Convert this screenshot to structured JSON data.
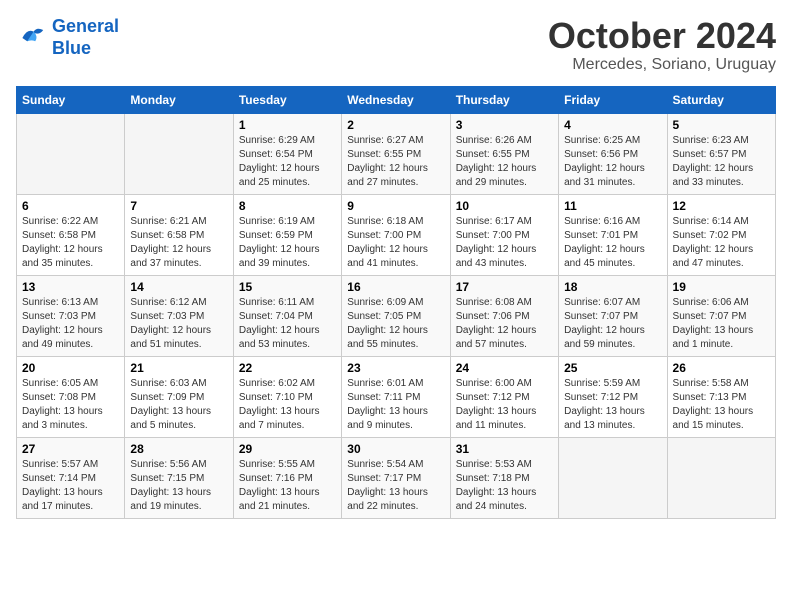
{
  "header": {
    "logo_line1": "General",
    "logo_line2": "Blue",
    "month": "October 2024",
    "location": "Mercedes, Soriano, Uruguay"
  },
  "weekdays": [
    "Sunday",
    "Monday",
    "Tuesday",
    "Wednesday",
    "Thursday",
    "Friday",
    "Saturday"
  ],
  "weeks": [
    [
      {
        "day": "",
        "sunrise": "",
        "sunset": "",
        "daylight": ""
      },
      {
        "day": "",
        "sunrise": "",
        "sunset": "",
        "daylight": ""
      },
      {
        "day": "1",
        "sunrise": "Sunrise: 6:29 AM",
        "sunset": "Sunset: 6:54 PM",
        "daylight": "Daylight: 12 hours and 25 minutes."
      },
      {
        "day": "2",
        "sunrise": "Sunrise: 6:27 AM",
        "sunset": "Sunset: 6:55 PM",
        "daylight": "Daylight: 12 hours and 27 minutes."
      },
      {
        "day": "3",
        "sunrise": "Sunrise: 6:26 AM",
        "sunset": "Sunset: 6:55 PM",
        "daylight": "Daylight: 12 hours and 29 minutes."
      },
      {
        "day": "4",
        "sunrise": "Sunrise: 6:25 AM",
        "sunset": "Sunset: 6:56 PM",
        "daylight": "Daylight: 12 hours and 31 minutes."
      },
      {
        "day": "5",
        "sunrise": "Sunrise: 6:23 AM",
        "sunset": "Sunset: 6:57 PM",
        "daylight": "Daylight: 12 hours and 33 minutes."
      }
    ],
    [
      {
        "day": "6",
        "sunrise": "Sunrise: 6:22 AM",
        "sunset": "Sunset: 6:58 PM",
        "daylight": "Daylight: 12 hours and 35 minutes."
      },
      {
        "day": "7",
        "sunrise": "Sunrise: 6:21 AM",
        "sunset": "Sunset: 6:58 PM",
        "daylight": "Daylight: 12 hours and 37 minutes."
      },
      {
        "day": "8",
        "sunrise": "Sunrise: 6:19 AM",
        "sunset": "Sunset: 6:59 PM",
        "daylight": "Daylight: 12 hours and 39 minutes."
      },
      {
        "day": "9",
        "sunrise": "Sunrise: 6:18 AM",
        "sunset": "Sunset: 7:00 PM",
        "daylight": "Daylight: 12 hours and 41 minutes."
      },
      {
        "day": "10",
        "sunrise": "Sunrise: 6:17 AM",
        "sunset": "Sunset: 7:00 PM",
        "daylight": "Daylight: 12 hours and 43 minutes."
      },
      {
        "day": "11",
        "sunrise": "Sunrise: 6:16 AM",
        "sunset": "Sunset: 7:01 PM",
        "daylight": "Daylight: 12 hours and 45 minutes."
      },
      {
        "day": "12",
        "sunrise": "Sunrise: 6:14 AM",
        "sunset": "Sunset: 7:02 PM",
        "daylight": "Daylight: 12 hours and 47 minutes."
      }
    ],
    [
      {
        "day": "13",
        "sunrise": "Sunrise: 6:13 AM",
        "sunset": "Sunset: 7:03 PM",
        "daylight": "Daylight: 12 hours and 49 minutes."
      },
      {
        "day": "14",
        "sunrise": "Sunrise: 6:12 AM",
        "sunset": "Sunset: 7:03 PM",
        "daylight": "Daylight: 12 hours and 51 minutes."
      },
      {
        "day": "15",
        "sunrise": "Sunrise: 6:11 AM",
        "sunset": "Sunset: 7:04 PM",
        "daylight": "Daylight: 12 hours and 53 minutes."
      },
      {
        "day": "16",
        "sunrise": "Sunrise: 6:09 AM",
        "sunset": "Sunset: 7:05 PM",
        "daylight": "Daylight: 12 hours and 55 minutes."
      },
      {
        "day": "17",
        "sunrise": "Sunrise: 6:08 AM",
        "sunset": "Sunset: 7:06 PM",
        "daylight": "Daylight: 12 hours and 57 minutes."
      },
      {
        "day": "18",
        "sunrise": "Sunrise: 6:07 AM",
        "sunset": "Sunset: 7:07 PM",
        "daylight": "Daylight: 12 hours and 59 minutes."
      },
      {
        "day": "19",
        "sunrise": "Sunrise: 6:06 AM",
        "sunset": "Sunset: 7:07 PM",
        "daylight": "Daylight: 13 hours and 1 minute."
      }
    ],
    [
      {
        "day": "20",
        "sunrise": "Sunrise: 6:05 AM",
        "sunset": "Sunset: 7:08 PM",
        "daylight": "Daylight: 13 hours and 3 minutes."
      },
      {
        "day": "21",
        "sunrise": "Sunrise: 6:03 AM",
        "sunset": "Sunset: 7:09 PM",
        "daylight": "Daylight: 13 hours and 5 minutes."
      },
      {
        "day": "22",
        "sunrise": "Sunrise: 6:02 AM",
        "sunset": "Sunset: 7:10 PM",
        "daylight": "Daylight: 13 hours and 7 minutes."
      },
      {
        "day": "23",
        "sunrise": "Sunrise: 6:01 AM",
        "sunset": "Sunset: 7:11 PM",
        "daylight": "Daylight: 13 hours and 9 minutes."
      },
      {
        "day": "24",
        "sunrise": "Sunrise: 6:00 AM",
        "sunset": "Sunset: 7:12 PM",
        "daylight": "Daylight: 13 hours and 11 minutes."
      },
      {
        "day": "25",
        "sunrise": "Sunrise: 5:59 AM",
        "sunset": "Sunset: 7:12 PM",
        "daylight": "Daylight: 13 hours and 13 minutes."
      },
      {
        "day": "26",
        "sunrise": "Sunrise: 5:58 AM",
        "sunset": "Sunset: 7:13 PM",
        "daylight": "Daylight: 13 hours and 15 minutes."
      }
    ],
    [
      {
        "day": "27",
        "sunrise": "Sunrise: 5:57 AM",
        "sunset": "Sunset: 7:14 PM",
        "daylight": "Daylight: 13 hours and 17 minutes."
      },
      {
        "day": "28",
        "sunrise": "Sunrise: 5:56 AM",
        "sunset": "Sunset: 7:15 PM",
        "daylight": "Daylight: 13 hours and 19 minutes."
      },
      {
        "day": "29",
        "sunrise": "Sunrise: 5:55 AM",
        "sunset": "Sunset: 7:16 PM",
        "daylight": "Daylight: 13 hours and 21 minutes."
      },
      {
        "day": "30",
        "sunrise": "Sunrise: 5:54 AM",
        "sunset": "Sunset: 7:17 PM",
        "daylight": "Daylight: 13 hours and 22 minutes."
      },
      {
        "day": "31",
        "sunrise": "Sunrise: 5:53 AM",
        "sunset": "Sunset: 7:18 PM",
        "daylight": "Daylight: 13 hours and 24 minutes."
      },
      {
        "day": "",
        "sunrise": "",
        "sunset": "",
        "daylight": ""
      },
      {
        "day": "",
        "sunrise": "",
        "sunset": "",
        "daylight": ""
      }
    ]
  ]
}
